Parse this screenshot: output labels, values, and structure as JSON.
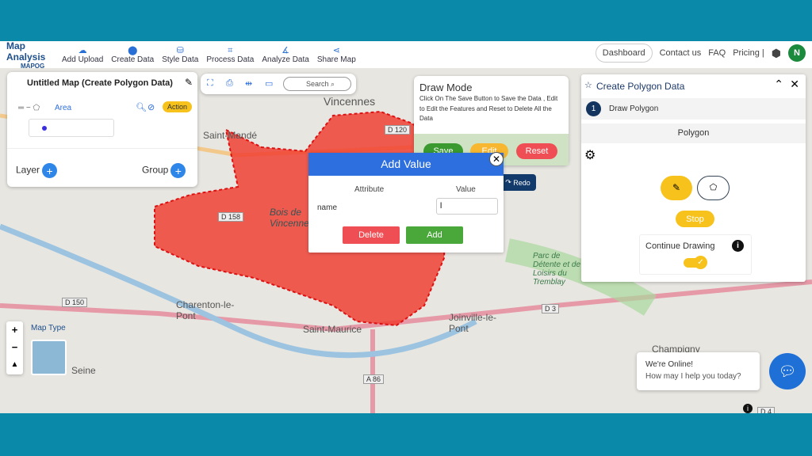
{
  "header": {
    "logo_title": "Map Analysis",
    "logo_sub": "MAPOG",
    "nav": [
      {
        "label": "Add Upload",
        "icon": "cloud-upload-icon"
      },
      {
        "label": "Create Data",
        "icon": "map-pin-icon"
      },
      {
        "label": "Style Data",
        "icon": "paint-bucket-icon"
      },
      {
        "label": "Process Data",
        "icon": "process-icon"
      },
      {
        "label": "Analyze Data",
        "icon": "analyze-icon"
      },
      {
        "label": "Share Map",
        "icon": "share-icon"
      }
    ],
    "dashboard": "Dashboard",
    "contact": "Contact us",
    "faq": "FAQ",
    "pricing": "Pricing |",
    "avatar": "N"
  },
  "layer_panel": {
    "title": "Untitled Map (Create Polygon Data)",
    "layer_name": "Area",
    "action": "Action",
    "layer_label": "Layer",
    "group_label": "Group"
  },
  "toolbar": {
    "search_placeholder": "Search"
  },
  "draw_mode": {
    "title": "Draw Mode",
    "text": "Click On The Save Button to Save the Data , Edit to Edit the Features and Reset to Delete All the Data",
    "save": "Save",
    "edit": "Edit",
    "reset": "Reset",
    "redo": "Redo"
  },
  "dialog": {
    "title": "Add Value",
    "col_attr": "Attribute",
    "col_value": "Value",
    "attr": "name",
    "value": "l",
    "delete": "Delete",
    "add": "Add"
  },
  "create_panel": {
    "title": "Create Polygon Data",
    "step_num": "1",
    "step": "Draw Polygon",
    "section": "Polygon",
    "stop": "Stop",
    "continue": "Continue Drawing",
    "continue_on": true
  },
  "map": {
    "map_type": "Map Type",
    "labels": [
      "Vincennes",
      "Saint-Mandé",
      "Bois de Vincennes",
      "Charenton-le-Pont",
      "Saint-Maurice",
      "Joinville-le-Pont",
      "Seine",
      "Champigny",
      "Parc de Détente et de Loisirs du Tremblay"
    ],
    "roads": [
      "D 158",
      "D 150",
      "D 3",
      "A 86",
      "D 120",
      "D 4"
    ]
  },
  "chat": {
    "line1": "We're Online!",
    "line2": "How may I help you today?"
  },
  "colors": {
    "polygon": "#f03a2e",
    "teal": "#0a8aa8",
    "blue": "#2e6fe0",
    "green": "#3a9a2f",
    "yellow": "#f7c21c",
    "red": "#ef4f54"
  }
}
